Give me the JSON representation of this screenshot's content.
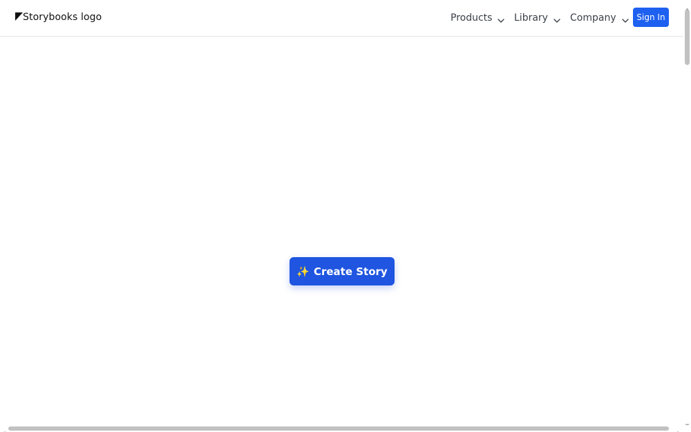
{
  "header": {
    "logo_alt": "Storybooks logo",
    "nav": [
      {
        "label": "Products"
      },
      {
        "label": "Library"
      },
      {
        "label": "Company"
      }
    ],
    "sign_in_label": "Sign In"
  },
  "main": {
    "cta_icon": "✨",
    "cta_label": "Create Story"
  },
  "colors": {
    "accent": "#1e61f0",
    "cta_background": "#1f55e0"
  },
  "scrollbars": {
    "vertical": true,
    "horizontal": true
  }
}
